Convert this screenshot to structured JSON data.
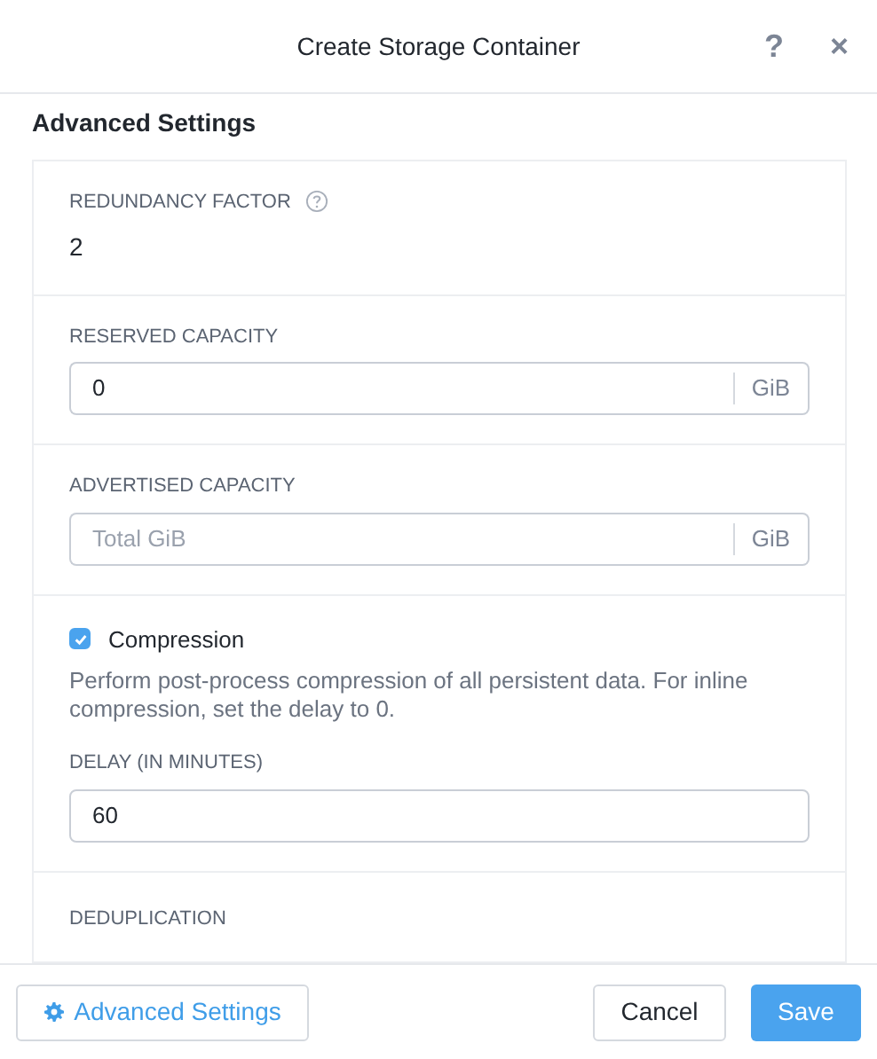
{
  "dialog": {
    "title": "Create Storage Container",
    "help": "?",
    "close": "×"
  },
  "section_title": "Advanced Settings",
  "fields": [
    {
      "kind": "static",
      "label": "REDUNDANCY FACTOR",
      "has_help": true,
      "value": "2"
    },
    {
      "kind": "unit_input",
      "label": "RESERVED CAPACITY",
      "value": "0",
      "unit": "GiB"
    },
    {
      "kind": "unit_input",
      "label": "ADVERTISED CAPACITY",
      "placeholder": "Total GiB",
      "unit": "GiB"
    },
    {
      "kind": "checkbox_group",
      "label": "Compression",
      "checked": true,
      "description": "Perform post-process compression of all persistent data. For inline compression, set the delay to 0.",
      "sub_label": "DELAY (IN MINUTES)",
      "value": "60"
    },
    {
      "kind": "heading",
      "label": "DEDUPLICATION"
    }
  ],
  "footer": {
    "advanced_button": "Advanced Settings",
    "cancel": "Cancel",
    "save": "Save"
  }
}
